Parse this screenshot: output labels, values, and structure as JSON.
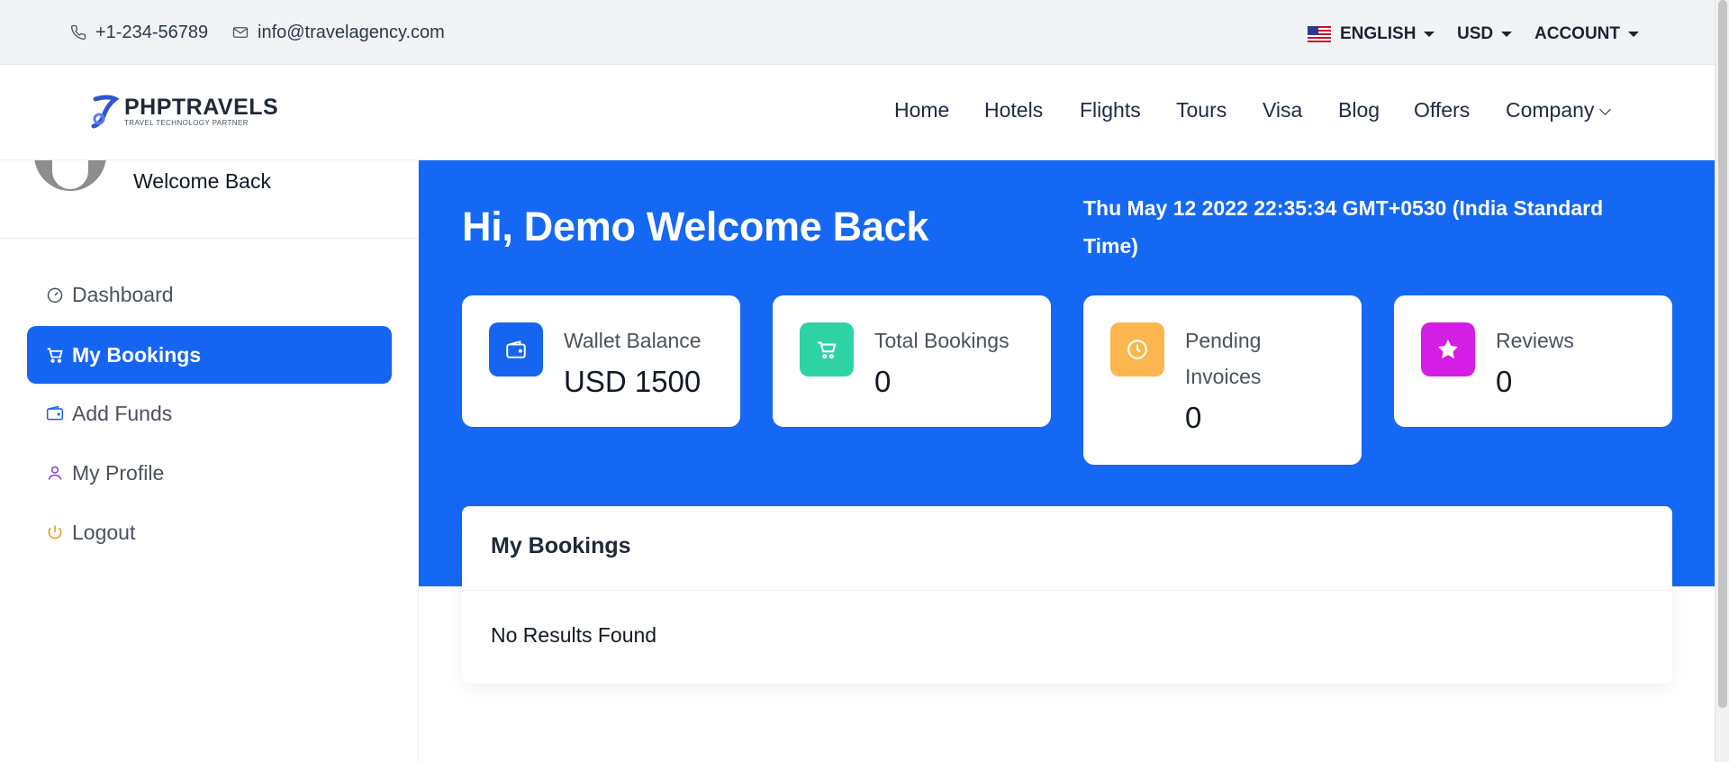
{
  "topbar": {
    "phone": "+1-234-56789",
    "email": "info@travelagency.com",
    "language": "ENGLISH",
    "currency": "USD",
    "account": "ACCOUNT"
  },
  "logo": {
    "title": "PHPTRAVELS",
    "subtitle": "TRAVEL TECHNOLOGY PARTNER"
  },
  "nav": {
    "items": [
      "Home",
      "Hotels",
      "Flights",
      "Tours",
      "Visa",
      "Blog",
      "Offers",
      "Company"
    ]
  },
  "sidebar": {
    "welcome": "Welcome Back",
    "items": [
      {
        "label": "Dashboard",
        "icon": "dashboard-icon"
      },
      {
        "label": "My Bookings",
        "icon": "cart-icon",
        "active": true
      },
      {
        "label": "Add Funds",
        "icon": "wallet-icon"
      },
      {
        "label": "My Profile",
        "icon": "user-icon"
      },
      {
        "label": "Logout",
        "icon": "power-icon"
      }
    ]
  },
  "hero": {
    "title": "Hi, Demo Welcome Back",
    "datetime": "Thu May 12 2022 22:35:34 GMT+0530 (India Standard Time)"
  },
  "cards": [
    {
      "label": "Wallet Balance",
      "value": "USD 1500",
      "icon": "wallet-icon",
      "color": "#1665f2"
    },
    {
      "label": "Total Bookings",
      "value": "0",
      "icon": "cart-icon",
      "color": "#2ed3a4"
    },
    {
      "label": "Pending Invoices",
      "value": "0",
      "icon": "clock-icon",
      "color": "#fbb74e"
    },
    {
      "label": "Reviews",
      "value": "0",
      "icon": "star-icon",
      "color": "#d41ee6"
    }
  ],
  "bookings": {
    "title": "My Bookings",
    "empty": "No Results Found"
  },
  "colors": {
    "primary": "#1468f3",
    "topbar_bg": "#f1f3f6"
  }
}
